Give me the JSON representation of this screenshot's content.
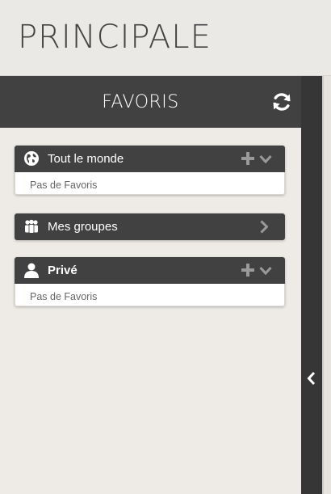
{
  "page": {
    "title": "PRINCIPALE"
  },
  "panel": {
    "title": "FAVORIS",
    "refresh_icon": "refresh-icon",
    "collapse_icon": "chevron-left-icon"
  },
  "sections": [
    {
      "label": "Tout le monde",
      "icon": "globe-icon",
      "empty_text": "Pas de Favoris",
      "actions": [
        "plus-icon",
        "chevron-down-icon"
      ]
    },
    {
      "label": "Mes groupes",
      "icon": "group-icon",
      "actions": [
        "chevron-right-icon"
      ]
    },
    {
      "label": "Privé",
      "icon": "user-icon",
      "empty_text": "Pas de Favoris",
      "actions": [
        "plus-icon",
        "chevron-down-icon"
      ]
    }
  ],
  "colors": {
    "header_dark": "#414141",
    "rail_dark": "#363636",
    "background": "#eeebe6",
    "icon_gray": "#9a9a9a"
  }
}
